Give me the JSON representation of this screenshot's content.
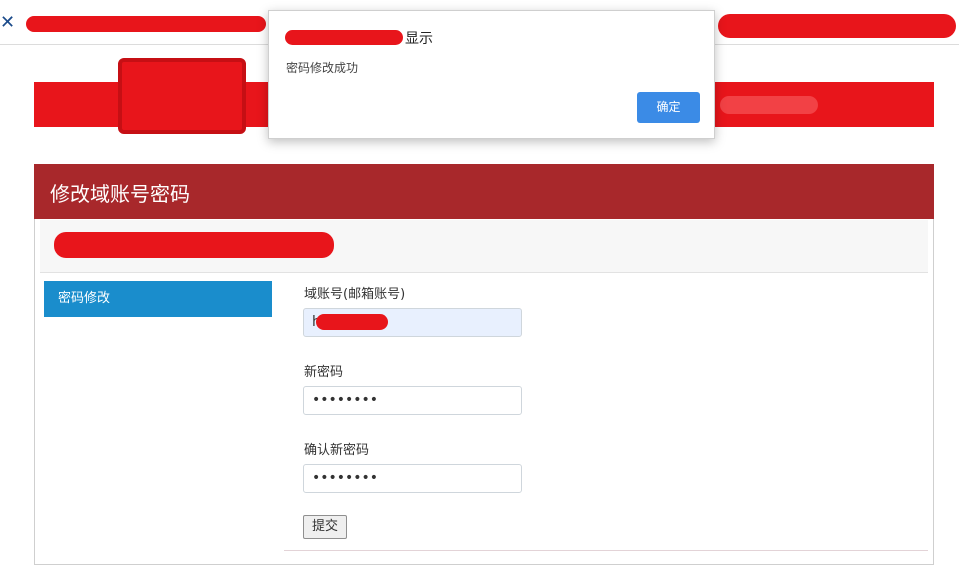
{
  "browser": {
    "bookmark_icon": "x-logo-icon"
  },
  "panel": {
    "title": "修改域账号密码"
  },
  "sidebar": {
    "items": [
      {
        "label": "密码修改"
      }
    ]
  },
  "form": {
    "account_label": "域账号(邮箱账号)",
    "account_value": "h",
    "new_password_label": "新密码",
    "new_password_value": "••••••••",
    "confirm_password_label": "确认新密码",
    "confirm_password_value": "••••••••",
    "submit_label": "提交"
  },
  "dialog": {
    "title_suffix": "显示",
    "message": "密码修改成功",
    "ok_label": "确定"
  },
  "colors": {
    "banner_red": "#e8151b",
    "panel_header": "#a8282b",
    "sidebar_active": "#1a8dcc",
    "dialog_button": "#3b8be6"
  }
}
